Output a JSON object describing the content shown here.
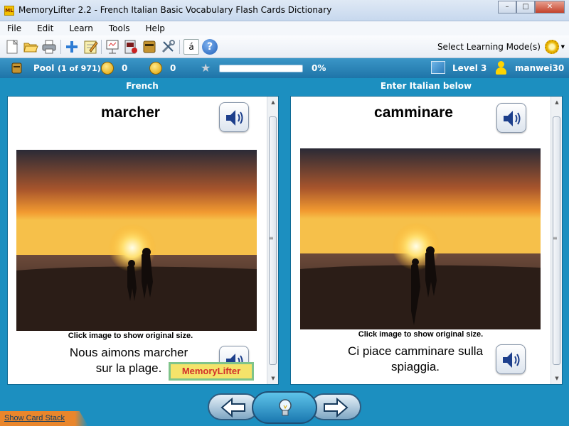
{
  "window": {
    "title": "MemoryLifter 2.2 - French Italian Basic Vocabulary Flash Cards Dictionary",
    "app_icon_text": "ML"
  },
  "menu": [
    "File",
    "Edit",
    "Learn",
    "Tools",
    "Help"
  ],
  "toolbar": {
    "icons": [
      "new-icon",
      "open-icon",
      "print-icon",
      "add-card-icon",
      "edit-icon",
      "presentation-icon",
      "statistics-icon",
      "dictionary-icon",
      "tools-icon",
      "special-char-icon",
      "help-icon"
    ],
    "special_char_label": "á",
    "help_label": "?",
    "select_mode_label": "Select Learning Mode(s)"
  },
  "status": {
    "pool_label": "Pool",
    "pool_count": "(1 of 971)",
    "happy_count": "0",
    "sad_count": "0",
    "progress_percent": 0,
    "progress_text": "0%",
    "level": "Level 3",
    "user": "manwei30"
  },
  "question": {
    "panel_title": "French",
    "word": "marcher",
    "caption": "Click image to show original size.",
    "sentence_line1": "Nous aimons marcher",
    "sentence_line2": "sur la plage.",
    "watermark": "MemoryLifter"
  },
  "answer": {
    "panel_title": "Enter Italian below",
    "word": "camminare",
    "caption": "Click image to show original size.",
    "sentence_line1": "Ci piace camminare sulla",
    "sentence_line2": "spiaggia."
  },
  "bottom": {
    "show_card_stack": "Show Card Stack"
  },
  "colors": {
    "main_blue": "#1c8fc0",
    "status_blue": "#2a86bd",
    "accent_orange": "#e9862c"
  }
}
